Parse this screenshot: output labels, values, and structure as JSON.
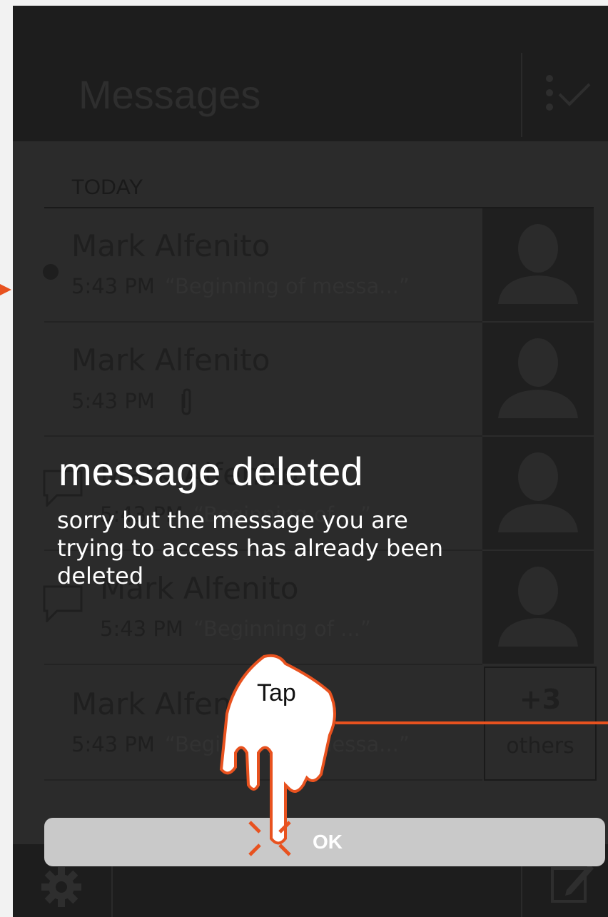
{
  "header": {
    "title": "Messages",
    "select_icon": "select-check-icon"
  },
  "section": {
    "label": "TODAY"
  },
  "messages": [
    {
      "name": "Mark Alfenito",
      "time": "5:43 PM",
      "preview": "“Beginning of messa...”",
      "unread": true
    },
    {
      "name": "Mark Alfenito",
      "time": "5:43 PM",
      "preview": "",
      "attachment": true
    },
    {
      "name": "Mark Alfenito",
      "time": "5:43 PM",
      "preview": "“Beginning of ...”"
    },
    {
      "name": "Mark Alfenito",
      "time": "5:43 PM",
      "preview": "“Beginning of ...”"
    },
    {
      "name": "Mark Alfenito",
      "time": "5:43 PM",
      "preview": "“Beginning of messa...”"
    }
  ],
  "others": {
    "count": "+3",
    "label": "others"
  },
  "dialog": {
    "title": "message deleted",
    "message": "sorry but the message you are trying to access has already been deleted",
    "ok_label": "OK"
  },
  "annotation": {
    "tap_label": "Tap"
  },
  "colors": {
    "accent": "#e8521f",
    "dialog_button": "#c9c9c9",
    "text": "#ffffff"
  }
}
